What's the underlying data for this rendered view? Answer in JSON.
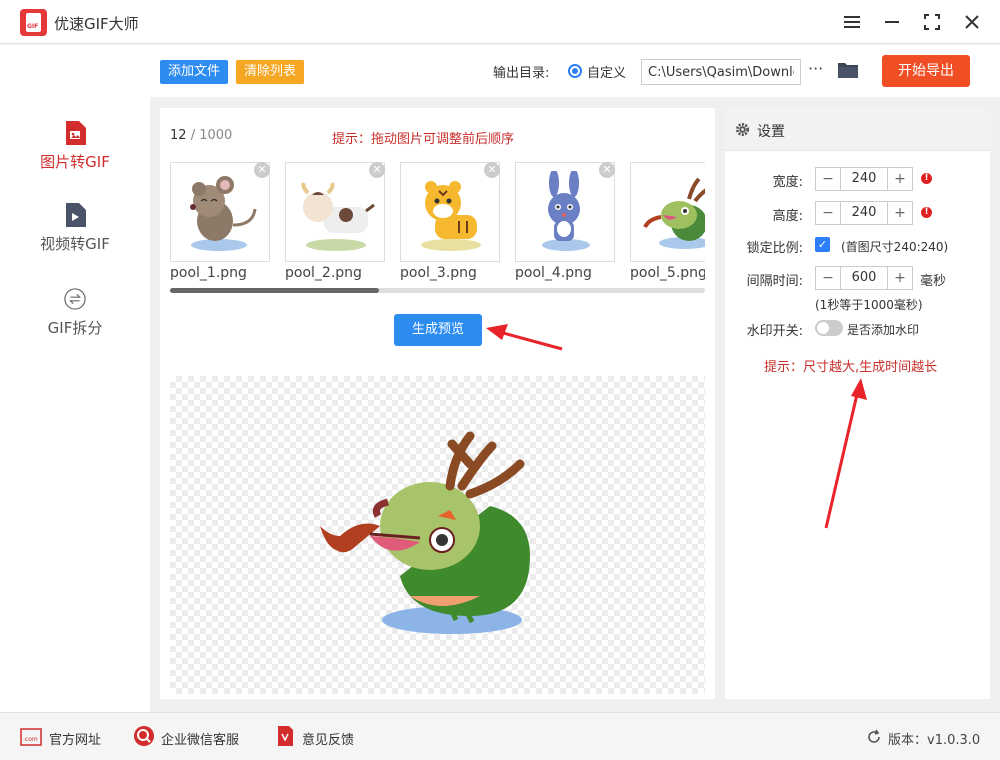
{
  "app": {
    "title": "优速GIF大师",
    "logo_text": "GIF"
  },
  "window_controls": {
    "menu": "≡",
    "minimize": "—",
    "maximize": "⛶",
    "close": "✕"
  },
  "sidebar": {
    "items": [
      {
        "label": "图片转GIF",
        "icon": "image-file-icon",
        "active": true
      },
      {
        "label": "视频转GIF",
        "icon": "video-file-icon",
        "active": false
      },
      {
        "label": "GIF拆分",
        "icon": "split-icon",
        "active": false
      }
    ]
  },
  "toolbar": {
    "add_file": "添加文件",
    "clear_list": "清除列表",
    "output_label": "输出目录:",
    "custom_label": "自定义",
    "output_path": "C:\\Users\\Qasim\\Downloads",
    "more": "···",
    "export": "开始导出",
    "colors": {
      "add": "#2d8cf0",
      "clear": "#f5a623",
      "export": "#f04f25"
    }
  },
  "main": {
    "count": "12",
    "max_count": "/ 1000",
    "hint": "提示：拖动图片可调整前后顺序",
    "thumbnails": [
      {
        "name": "pool_1.png",
        "animal": "mouse"
      },
      {
        "name": "pool_2.png",
        "animal": "ox"
      },
      {
        "name": "pool_3.png",
        "animal": "tiger"
      },
      {
        "name": "pool_4.png",
        "animal": "rabbit"
      },
      {
        "name": "pool_5.png",
        "animal": "dragon"
      }
    ],
    "scroll_fraction": 0.39,
    "preview_button": "生成预览"
  },
  "settings": {
    "title": "设置",
    "width_label": "宽度:",
    "width_value": "240",
    "height_label": "高度:",
    "height_value": "240",
    "lock_label": "锁定比例:",
    "lock_note": "(首图尺寸240:240)",
    "interval_label": "间隔时间:",
    "interval_value": "600",
    "interval_unit": "毫秒",
    "interval_note": "(1秒等于1000毫秒)",
    "watermark_label": "水印开关:",
    "watermark_note": "是否添加水印",
    "tip": "提示：尺寸越大,生成时间越长"
  },
  "footer": {
    "website": "官方网址",
    "wechat": "企业微信客服",
    "feedback": "意见反馈",
    "version": "版本：v1.0.3.0"
  }
}
